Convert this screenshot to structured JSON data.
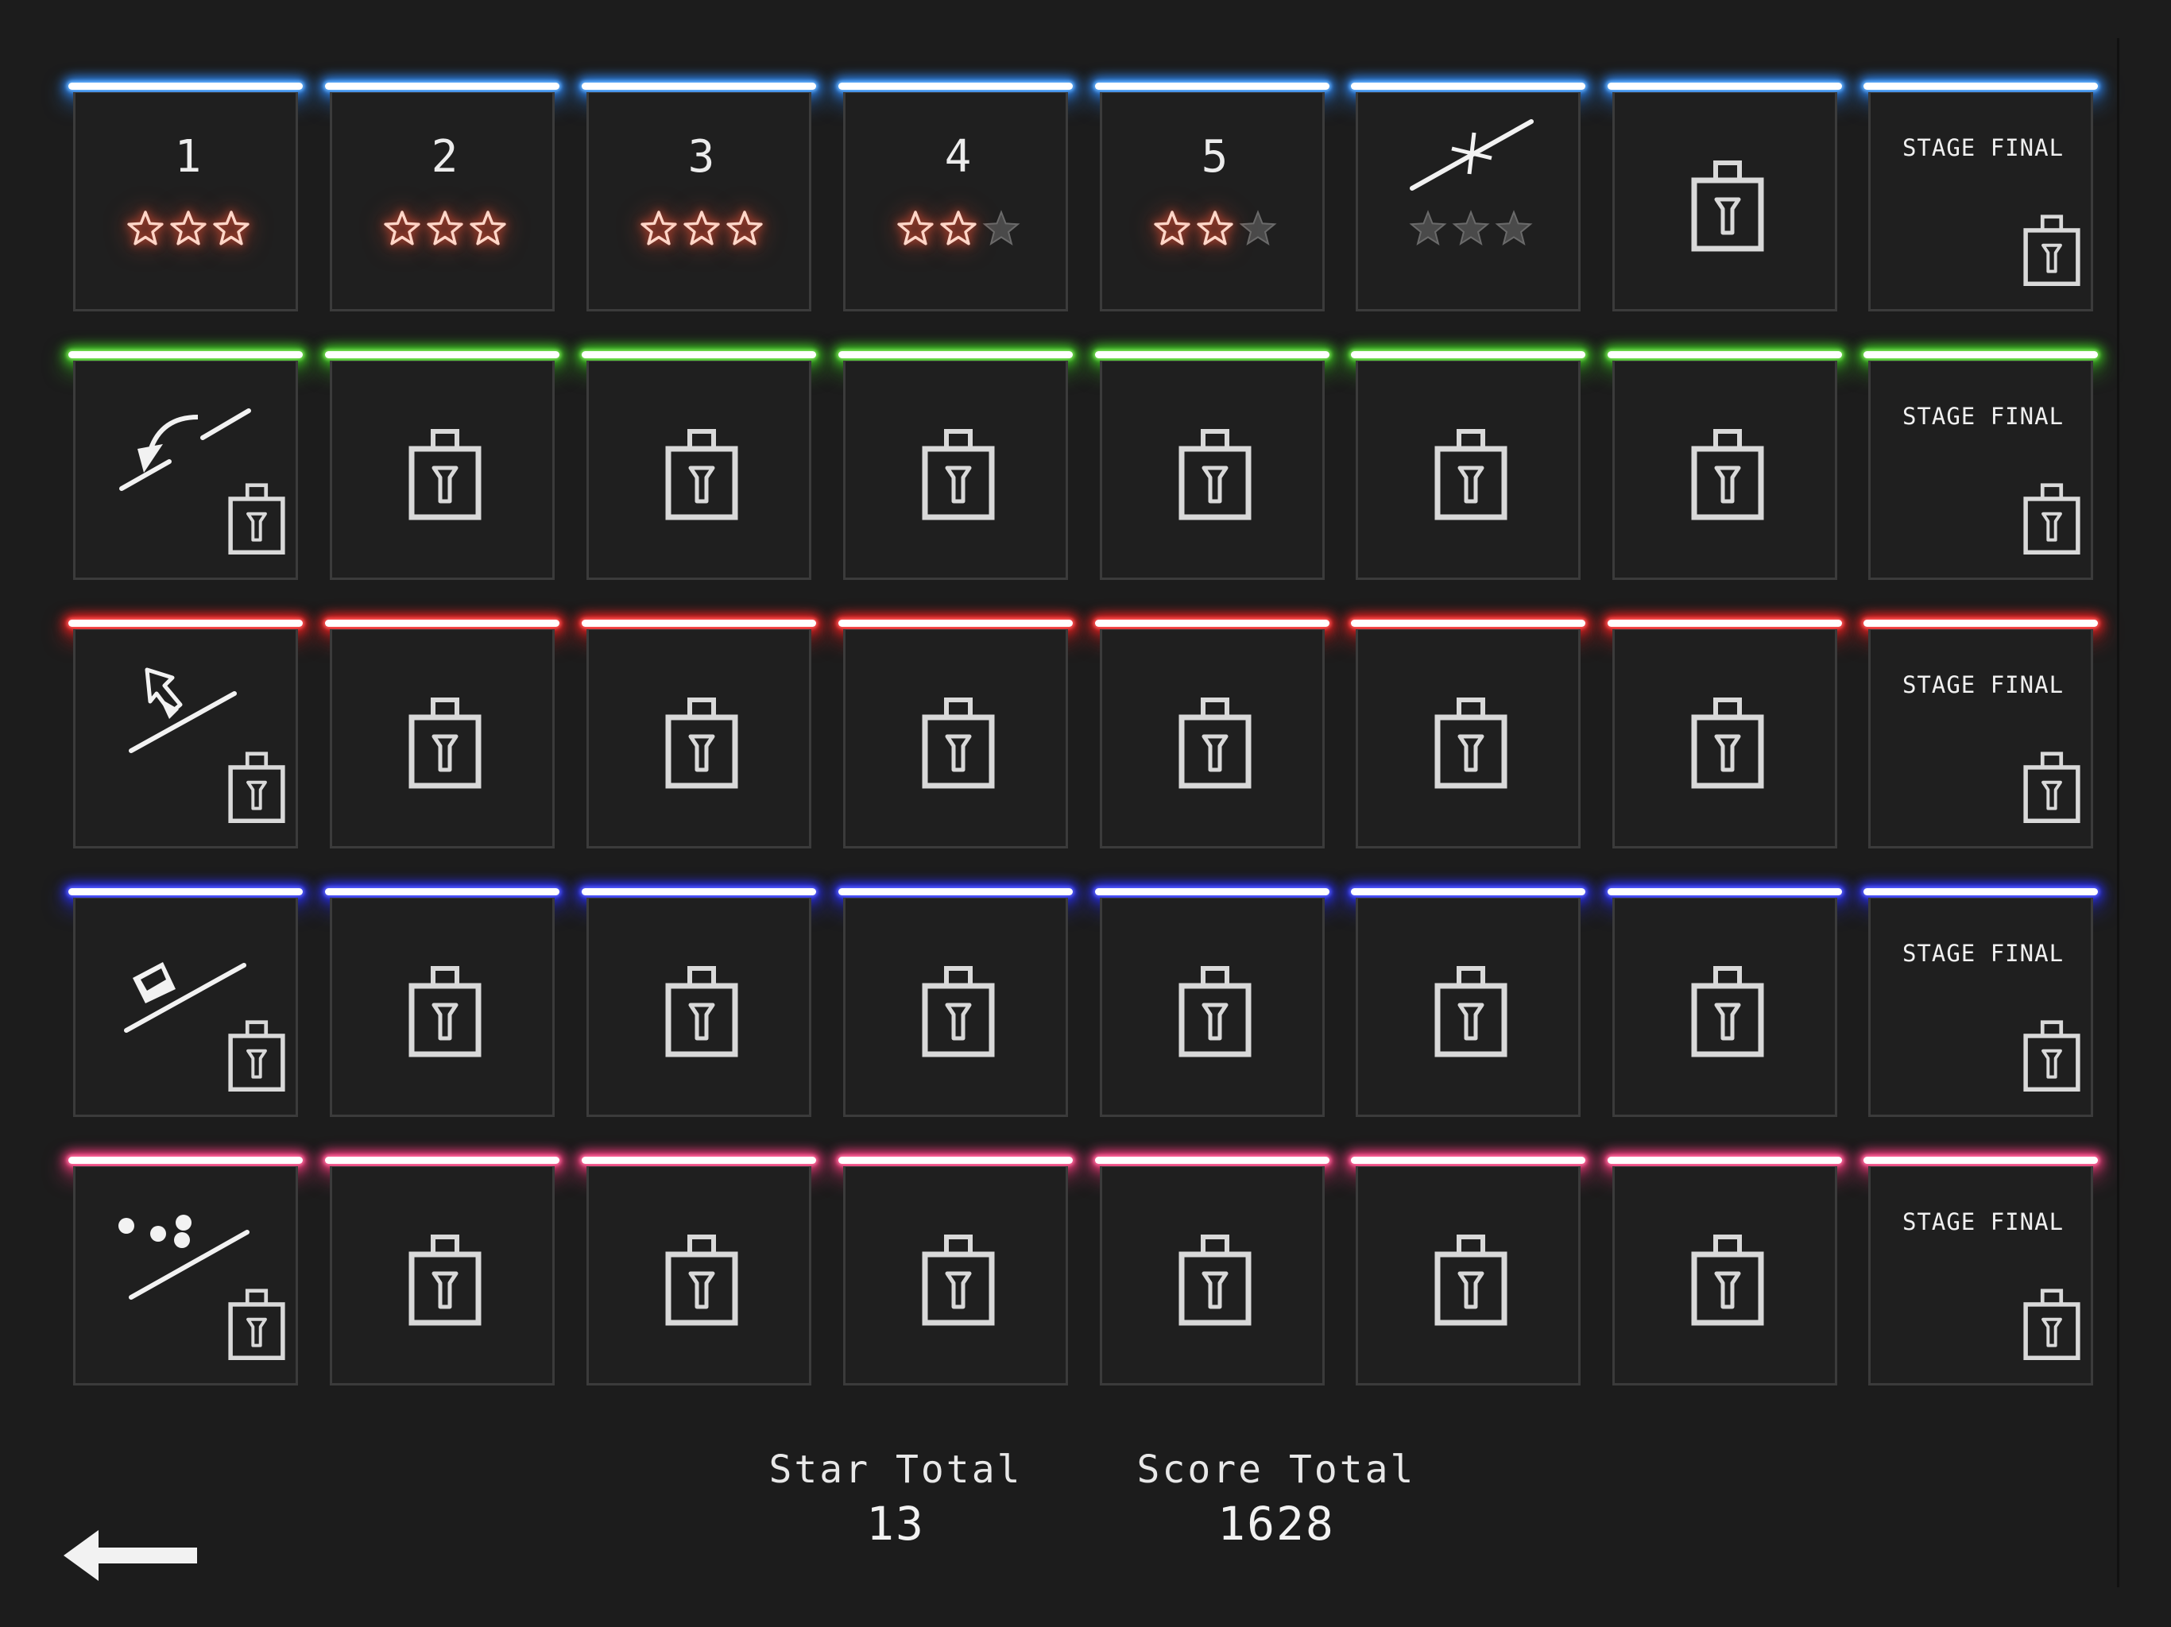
{
  "worlds": [
    {
      "color": "#6ab6ff",
      "glow": "#2f8cff",
      "first_icon": "number",
      "levels": [
        {
          "type": "unlocked",
          "label": "1",
          "stars": 3,
          "star_glyph": "star-icon"
        },
        {
          "type": "unlocked",
          "label": "2",
          "stars": 3,
          "star_glyph": "star-icon"
        },
        {
          "type": "unlocked",
          "label": "3",
          "stars": 3,
          "star_glyph": "star-icon"
        },
        {
          "type": "unlocked",
          "label": "4",
          "stars": 2,
          "star_glyph": "star-icon"
        },
        {
          "type": "unlocked",
          "label": "5",
          "stars": 2,
          "star_glyph": "star-icon"
        },
        {
          "type": "tool",
          "tool": "snap-line-icon",
          "stars": 0
        },
        {
          "type": "locked"
        },
        {
          "type": "final",
          "label": "STAGE FINAL"
        }
      ]
    },
    {
      "color": "#7ee35a",
      "glow": "#3fcf22",
      "levels": [
        {
          "type": "tool-locked",
          "tool": "rotate-line-icon"
        },
        {
          "type": "locked"
        },
        {
          "type": "locked"
        },
        {
          "type": "locked"
        },
        {
          "type": "locked"
        },
        {
          "type": "locked"
        },
        {
          "type": "locked"
        },
        {
          "type": "final",
          "label": "STAGE FINAL"
        }
      ]
    },
    {
      "color": "#ff5b5b",
      "glow": "#ff2020",
      "levels": [
        {
          "type": "tool-locked",
          "tool": "cursor-line-icon"
        },
        {
          "type": "locked"
        },
        {
          "type": "locked"
        },
        {
          "type": "locked"
        },
        {
          "type": "locked"
        },
        {
          "type": "locked"
        },
        {
          "type": "locked"
        },
        {
          "type": "final",
          "label": "STAGE FINAL"
        }
      ]
    },
    {
      "color": "#5c63ff",
      "glow": "#2a30ff",
      "levels": [
        {
          "type": "tool-locked",
          "tool": "eraser-line-icon"
        },
        {
          "type": "locked"
        },
        {
          "type": "locked"
        },
        {
          "type": "locked"
        },
        {
          "type": "locked"
        },
        {
          "type": "locked"
        },
        {
          "type": "locked"
        },
        {
          "type": "final",
          "label": "STAGE FINAL"
        }
      ]
    },
    {
      "color": "#ff6fa0",
      "glow": "#ff3c80",
      "levels": [
        {
          "type": "tool-locked",
          "tool": "balls-line-icon"
        },
        {
          "type": "locked"
        },
        {
          "type": "locked"
        },
        {
          "type": "locked"
        },
        {
          "type": "locked"
        },
        {
          "type": "locked"
        },
        {
          "type": "locked"
        },
        {
          "type": "final",
          "label": "STAGE FINAL"
        }
      ]
    }
  ],
  "colors": {
    "star_earned": "#ff6a4d",
    "star_empty": "#4a4a4a",
    "lock": "#d9d9d9",
    "panel_border": "#3b3b3b"
  },
  "totals": {
    "star_label": "Star Total",
    "star_value": "13",
    "score_label": "Score Total",
    "score_value": "1628"
  },
  "back_icon": "back-arrow-icon"
}
